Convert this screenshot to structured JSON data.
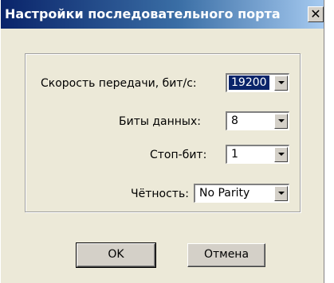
{
  "window": {
    "title": "Настройки последовательного порта",
    "close_symbol": "✕"
  },
  "fields": {
    "baud": {
      "label": "Скорость передачи, бит/с:",
      "value": "19200"
    },
    "data_bits": {
      "label": "Биты данных:",
      "value": "8"
    },
    "stop_bits": {
      "label": "Стоп-бит:",
      "value": "1"
    },
    "parity": {
      "label": "Чётность:",
      "value": "No Parity"
    }
  },
  "buttons": {
    "ok": "OK",
    "cancel": "Отмена"
  },
  "colors": {
    "titlebar_start": "#0a246a",
    "titlebar_end": "#a6caf0",
    "dialog_face": "#ece9d8",
    "selection": "#0a246a"
  }
}
